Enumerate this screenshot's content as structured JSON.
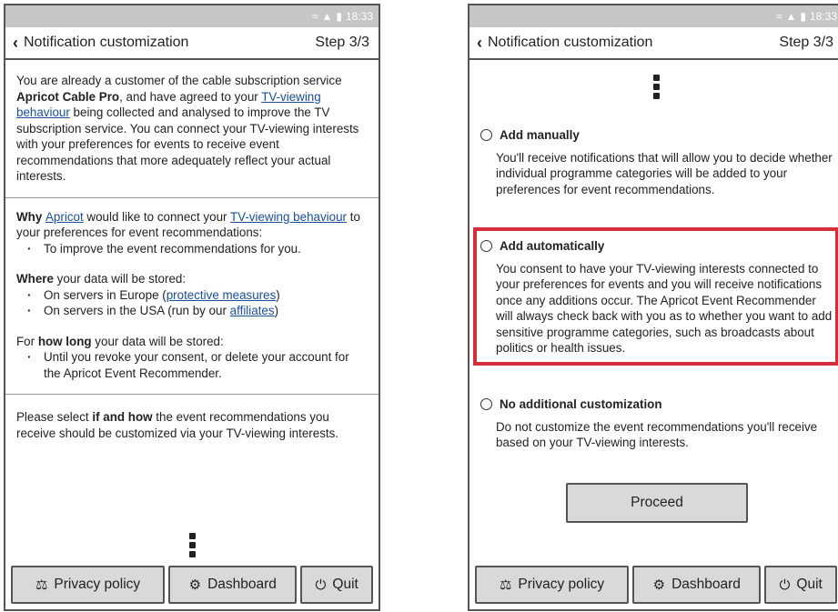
{
  "status": {
    "wifi_icon": "wifi-icon",
    "signal_icon": "signal-icon",
    "battery_icon": "battery-icon",
    "time": "18:33"
  },
  "header": {
    "title": "Notification customization",
    "step": "Step 3/3"
  },
  "left": {
    "intro": {
      "t1": "You are already a customer of the cable subscription service ",
      "brand": "Apricot Cable Pro",
      "t2": ", and have agreed to your ",
      "link": "TV-viewing behaviour",
      "t3": " being collected and analysed to improve the TV subscription service. You can connect your TV-viewing interests with your preferences for events to receive event recommendations that more adequately reflect your actual interests."
    },
    "why": {
      "t1": "Why ",
      "link_apricot": "Apricot",
      "t2": " would like to connect your ",
      "link_tv": "TV-viewing behaviour",
      "t3": " to your preferences for event recommendations:",
      "bullet": "To improve the event recommendations for you."
    },
    "where": {
      "bold": "Where",
      "t1": " your data will be stored:",
      "b1_text": "On servers in Europe (",
      "b1_link": "protective measures",
      "b1_end": ")",
      "b2_text": "On servers in the USA (run by our ",
      "b2_link": "affiliates",
      "b2_end": ")"
    },
    "howlong": {
      "t1": "For ",
      "bold": "how long",
      "t2": " your data will be stored:",
      "bullet": "Until you revoke your consent, or delete your account for the Apricot Event Recommender."
    },
    "select": {
      "t1": "Please select ",
      "bold": "if and how",
      "t2": " the event recommendations you receive should be customized via your TV-viewing interests."
    }
  },
  "right": {
    "options": [
      {
        "title": "Add manually",
        "desc": "You'll receive notifications that will allow you to decide whether individual programme categories will be added to your preferences for event recommendations."
      },
      {
        "title": "Add automatically",
        "desc": "You consent to have your TV-viewing interests connected to your preferences for events and you will receive notifications once any additions occur. The Apricot Event Recommender will always check back with you as to whether you want to add sensitive programme categories, such as broadcasts about politics or health issues."
      },
      {
        "title": "No additional customization",
        "desc": "Do not customize the event recommendations you'll receive based on your TV-viewing interests."
      }
    ],
    "proceed": "Proceed"
  },
  "bottom": {
    "privacy": "Privacy policy",
    "dashboard": "Dashboard",
    "quit": "Quit"
  },
  "colors": {
    "highlight": "#d32f3a",
    "link": "#1a4f9c",
    "status_bar": "#c6c6c6"
  }
}
